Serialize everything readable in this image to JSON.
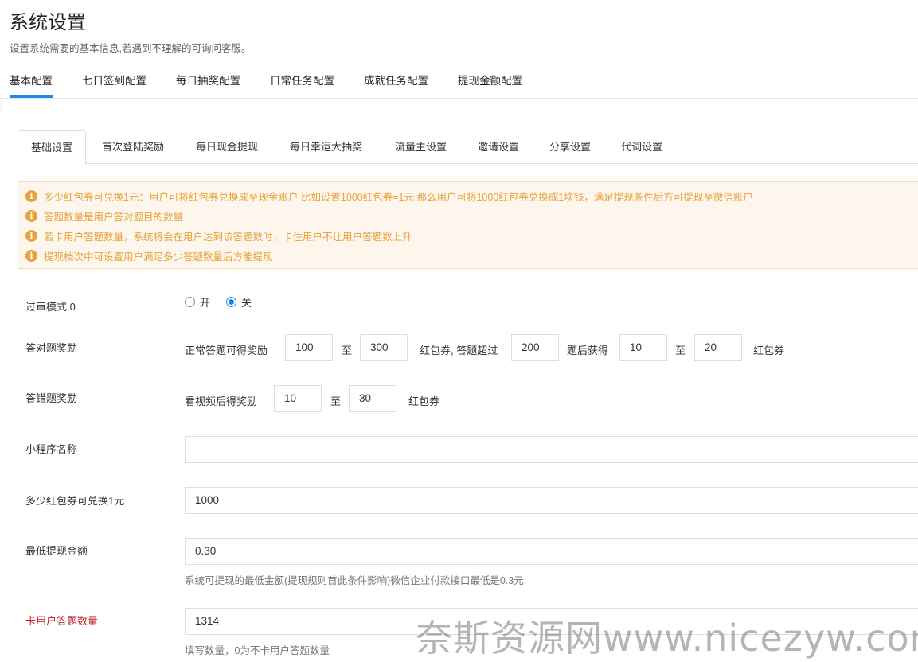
{
  "header": {
    "title": "系统设置",
    "subtitle": "设置系统需要的基本信息,若遇到不理解的可询问客服。"
  },
  "top_tabs": [
    "基本配置",
    "七日签到配置",
    "每日抽奖配置",
    "日常任务配置",
    "成就任务配置",
    "提现金额配置"
  ],
  "sub_tabs": [
    "基础设置",
    "首次登陆奖励",
    "每日现金提现",
    "每日幸运大抽奖",
    "流量主设置",
    "邀请设置",
    "分享设置",
    "代词设置"
  ],
  "notices": [
    "多少红包券可兑换1元：用户可将红包券兑换成至现金账户 比如设置1000红包券=1元 那么用户可将1000红包券兑换成1块钱，满足提现条件后方可提现至微信账户",
    "答题数量是用户答对题目的数量",
    "若卡用户答题数量，系统将会在用户达到该答题数时，卡住用户不让用户答题数上升",
    "提现档次中可设置用户满足多少答题数量后方能提现"
  ],
  "form": {
    "review_mode": {
      "label": "过审模式 0",
      "option_on": "开",
      "option_off": "关",
      "selected": "关"
    },
    "correct_reward": {
      "label": "答对题奖励",
      "prefix": "正常答题可得奖励",
      "min": "100",
      "to": "至",
      "max": "300",
      "mid_text": "红包券, 答题超过",
      "threshold": "200",
      "after_text": "题后获得",
      "after_min": "10",
      "to2": "至",
      "after_max": "20",
      "unit": "红包券"
    },
    "wrong_reward": {
      "label": "答错题奖励",
      "prefix": "看视频后得奖励",
      "min": "10",
      "to": "至",
      "max": "30",
      "unit": "红包券"
    },
    "app_name": {
      "label": "小程序名称",
      "value": ""
    },
    "exchange_rate": {
      "label": "多少红包券可兑换1元",
      "value": "1000"
    },
    "min_withdraw": {
      "label": "最低提现金额",
      "value": "0.30",
      "help": "系统可提现的最低金额(提现规则首此条件影响)微信企业付款接口最低是0.3元."
    },
    "limit_answers": {
      "label": "卡用户答题数量",
      "value": "1314",
      "help": "填写数量，0为不卡用户答题数量"
    }
  },
  "watermark": "奈斯资源网www.nicezyw.com",
  "colors": {
    "accent": "#1e88e5",
    "warning": "#e6a23c",
    "danger": "#c0262d"
  }
}
